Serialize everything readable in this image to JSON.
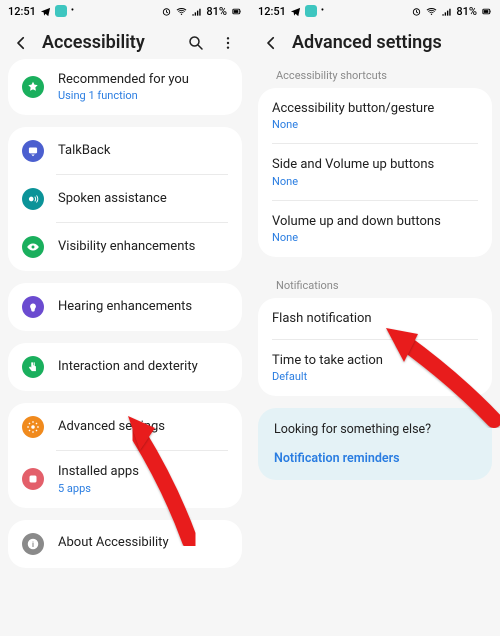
{
  "status": {
    "time": "12:51",
    "battery": "81%"
  },
  "screen_a": {
    "title": "Accessibility",
    "groups": [
      [
        {
          "label": "Recommended for you",
          "sub": "Using 1 function",
          "iconColor": "#1aaf5d",
          "iconName": "star-icon"
        }
      ],
      [
        {
          "label": "TalkBack",
          "iconColor": "#4b5fcf",
          "iconName": "talkback-icon"
        },
        {
          "label": "Spoken assistance",
          "iconColor": "#0b9398",
          "iconName": "spoken-icon"
        },
        {
          "label": "Visibility enhancements",
          "iconColor": "#1aaf5d",
          "iconName": "visibility-icon"
        }
      ],
      [
        {
          "label": "Hearing enhancements",
          "iconColor": "#6b4bd0",
          "iconName": "hearing-icon"
        }
      ],
      [
        {
          "label": "Interaction and dexterity",
          "iconColor": "#1aaf5d",
          "iconName": "interaction-icon"
        }
      ],
      [
        {
          "label": "Advanced settings",
          "iconColor": "#f08a1d",
          "iconName": "advanced-icon"
        },
        {
          "label": "Installed apps",
          "sub": "5 apps",
          "iconColor": "#e35f6a",
          "iconName": "installed-icon"
        }
      ],
      [
        {
          "label": "About Accessibility",
          "iconColor": "#8a8a8a",
          "iconName": "about-icon"
        }
      ]
    ]
  },
  "screen_b": {
    "title": "Advanced settings",
    "sections": [
      {
        "header": "Accessibility shortcuts",
        "items": [
          {
            "label": "Accessibility button/gesture",
            "sub": "None"
          },
          {
            "label": "Side and Volume up buttons",
            "sub": "None"
          },
          {
            "label": "Volume up and down buttons",
            "sub": "None"
          }
        ]
      },
      {
        "header": "Notifications",
        "items": [
          {
            "label": "Flash notification"
          },
          {
            "label": "Time to take action",
            "sub": "Default"
          }
        ]
      }
    ],
    "suggest": {
      "question": "Looking for something else?",
      "link": "Notification reminders"
    }
  }
}
